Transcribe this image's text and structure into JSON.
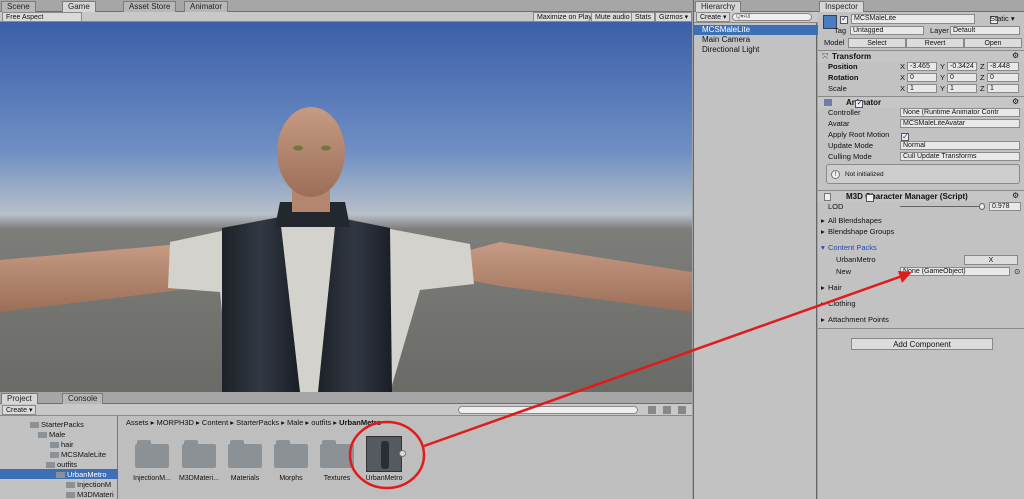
{
  "game_view": {
    "tabs": [
      "Scene",
      "Game",
      "Asset Store",
      "Animator"
    ],
    "aspect": "Free Aspect",
    "toggles": [
      "Maximize on Play",
      "Mute audio",
      "Stats",
      "Gizmos ▾"
    ]
  },
  "hierarchy": {
    "title": "Hierarchy",
    "create_label": "Create ▾",
    "search_placeholder": "Q▾All",
    "items": [
      "MCSMaleLite",
      "Main Camera",
      "Directional Light"
    ]
  },
  "inspector": {
    "title": "Inspector",
    "object_name": "MCSMaleLite",
    "static_label": "Static ▾",
    "tag_label": "Tag",
    "tag_value": "Untagged",
    "layer_label": "Layer",
    "layer_value": "Default",
    "model_label": "Model",
    "model_buttons": [
      "Select",
      "Revert",
      "Open"
    ],
    "transform": {
      "title": "Transform",
      "rows": [
        {
          "label": "Position",
          "x": "-3.465",
          "y": "-0.3424",
          "z": "-8.448"
        },
        {
          "label": "Rotation",
          "x": "0",
          "y": "0",
          "z": "0"
        },
        {
          "label": "Scale",
          "x": "1",
          "y": "1",
          "z": "1"
        }
      ]
    },
    "animator": {
      "title": "Animator",
      "rows": [
        {
          "label": "Controller",
          "value": "None (Runtime Animator Contr"
        },
        {
          "label": "Avatar",
          "value": "MCSMaleLiteAvatar"
        },
        {
          "label": "Apply Root Motion",
          "value": ""
        },
        {
          "label": "Update Mode",
          "value": "Normal"
        },
        {
          "label": "Culling Mode",
          "value": "Cull Update Transforms"
        }
      ],
      "note": "Not initialized"
    },
    "manager": {
      "title": "M3D Character Manager (Script)",
      "lod_label": "LOD",
      "lod_value": "0.978",
      "lod_fraction": 0.978,
      "sections": [
        "All Blendshapes",
        "Blendshape Groups",
        "Content Packs"
      ],
      "content_pack_item": "UrbanMetro",
      "remove_label": "X",
      "new_label": "New",
      "new_value": "None (GameObject)",
      "more_sections": [
        "Hair",
        "Clothing",
        "Attachment Points"
      ]
    },
    "add_component": "Add Component"
  },
  "project": {
    "tabs": [
      "Project",
      "Console"
    ],
    "create_label": "Create ▾",
    "breadcrumb": [
      "Assets",
      "MORPH3D",
      "Content",
      "StarterPacks",
      "Male",
      "outfits",
      "UrbanMetro"
    ],
    "tree": [
      "StarterPacks",
      "Male",
      "hair",
      "MCSMaleLite",
      "outfits",
      "UrbanMetro",
      "InjectionM",
      "M3DMateri"
    ],
    "folders": [
      "InjectionM...",
      "M3DMateri...",
      "Materials",
      "Morphs",
      "Textures",
      "UrbanMetro"
    ]
  },
  "colors": {
    "selection": "#3d6fb6",
    "annotation": "#e11b1b"
  }
}
